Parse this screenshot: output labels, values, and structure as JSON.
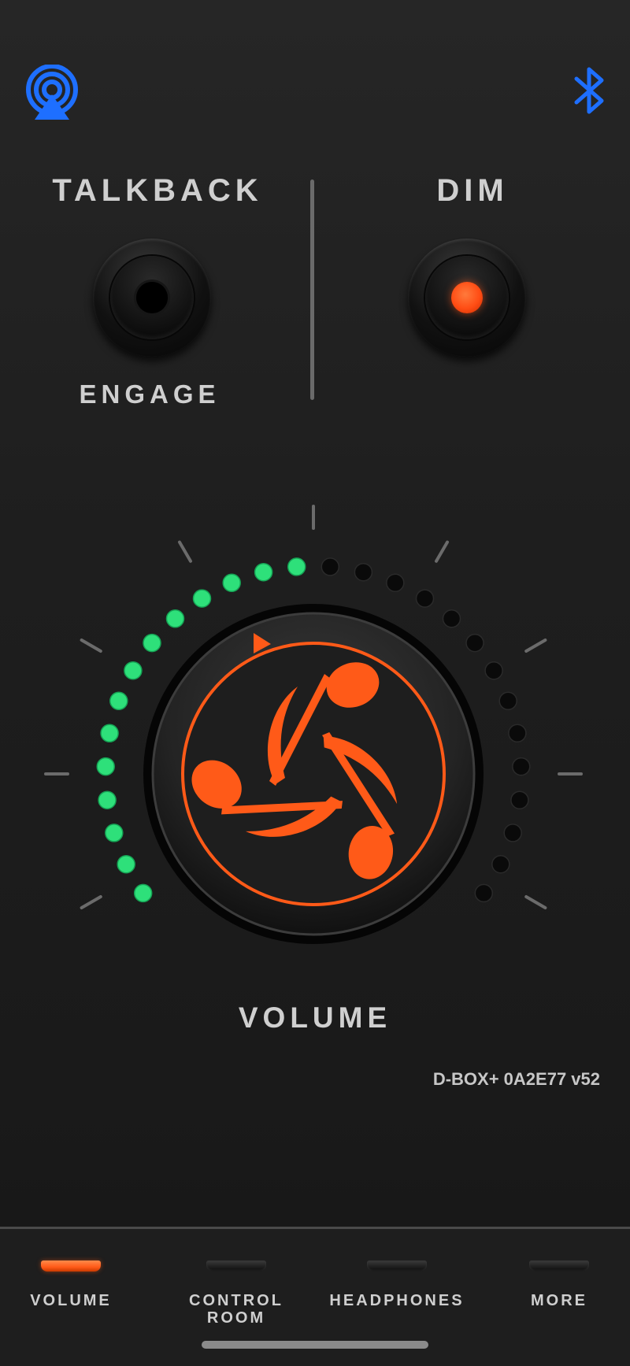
{
  "header": {
    "airplay_icon": "airplay-icon",
    "bluetooth_icon": "bluetooth-icon"
  },
  "talkback": {
    "title": "TALKBACK",
    "button_label": "ENGAGE"
  },
  "dim": {
    "title": "DIM",
    "state": "on"
  },
  "volume": {
    "label": "VOLUME",
    "knob_logo": "speaker-notes-logo",
    "leds_total": 28,
    "leds_lit": 14,
    "level": 0.5
  },
  "device": {
    "id_text": "D-BOX+ 0A2E77 v52"
  },
  "tabs": [
    {
      "label": "VOLUME",
      "active": true
    },
    {
      "label": "CONTROL\nROOM",
      "active": false
    },
    {
      "label": "HEADPHONES",
      "active": false
    },
    {
      "label": "MORE",
      "active": false
    }
  ],
  "colors": {
    "accent": "#ff5a18",
    "led_on": "#2ee07a",
    "led_off": "#0a0a0a",
    "link_blue": "#1e6fff"
  }
}
